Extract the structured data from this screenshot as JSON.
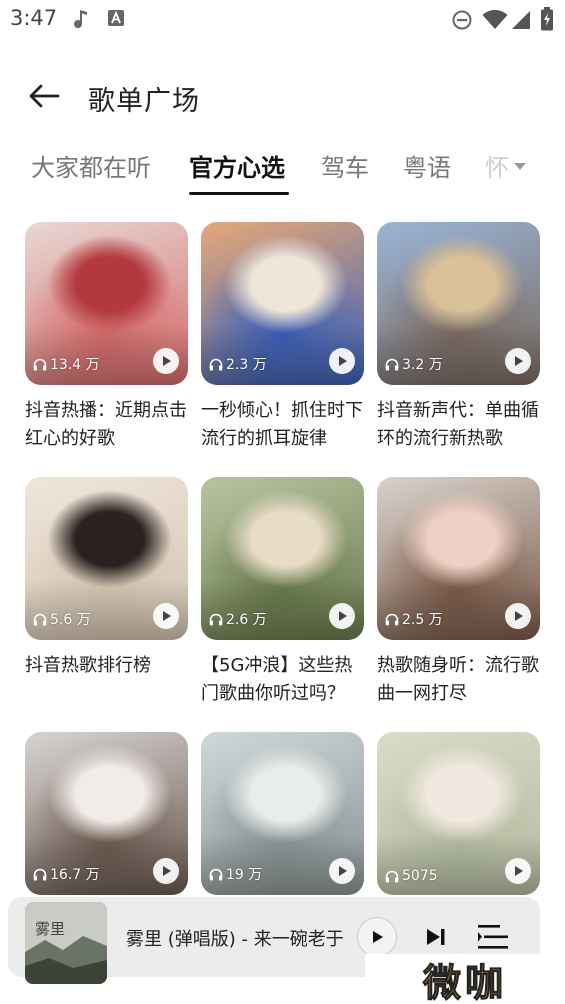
{
  "status_bar": {
    "time": "3:47",
    "icons": [
      "music-note-icon",
      "a-badge-icon",
      "do-not-disturb-icon",
      "wifi-icon",
      "signal-icon",
      "battery-charging-icon"
    ]
  },
  "header": {
    "back_icon": "back-arrow-icon",
    "title": "歌单广场"
  },
  "tabs": [
    {
      "label": "大家都在听",
      "active": false
    },
    {
      "label": "官方心选",
      "active": true
    },
    {
      "label": "驾车",
      "active": false
    },
    {
      "label": "粤语",
      "active": false
    },
    {
      "label": "怀",
      "active": false
    }
  ],
  "playlists": [
    {
      "title": "抖音热播：近期点击红心的好歌",
      "plays": "13.4 万",
      "palette": [
        "#e8d8d4",
        "#d46a6a",
        "#b23a3f"
      ]
    },
    {
      "title": "一秒倾心！抓住时下流行的抓耳旋律",
      "plays": "2.3 万",
      "palette": [
        "#e6a878",
        "#3a5fb8",
        "#f0e6d8"
      ]
    },
    {
      "title": "抖音新声代：单曲循环的流行新热歌",
      "plays": "3.2 万",
      "palette": [
        "#9ab4d6",
        "#7a6a60",
        "#d8c098"
      ]
    },
    {
      "title": "抖音热歌排行榜",
      "plays": "5.6 万",
      "palette": [
        "#efe6dc",
        "#d4c4b0",
        "#2a2220"
      ]
    },
    {
      "title": "【5G冲浪】这些热门歌曲你听过吗？",
      "plays": "2.6 万",
      "palette": [
        "#b8c4a0",
        "#6a7a4c",
        "#e8dcc8"
      ]
    },
    {
      "title": "热歌随身听：流行歌曲一网打尽",
      "plays": "2.5 万",
      "palette": [
        "#d8d2cc",
        "#7a5a48",
        "#f0d0c4"
      ]
    },
    {
      "title": "",
      "plays": "16.7 万",
      "palette": [
        "#d8d4d2",
        "#6a5a50",
        "#f2ece8"
      ]
    },
    {
      "title": "",
      "plays": "19 万",
      "palette": [
        "#cfd8d8",
        "#8a9494",
        "#e8ecec"
      ]
    },
    {
      "title": "",
      "plays": "5075",
      "palette": [
        "#d8dcc8",
        "#b4bca0",
        "#f2e8e0"
      ]
    }
  ],
  "mini_player": {
    "cover_text": "雾里",
    "song": "雾里 (弹唱版) - 来一碗老于",
    "play_icon": "play-icon",
    "next_icon": "skip-next-icon",
    "list_icon": "playlist-icon"
  },
  "watermark": "微咖"
}
